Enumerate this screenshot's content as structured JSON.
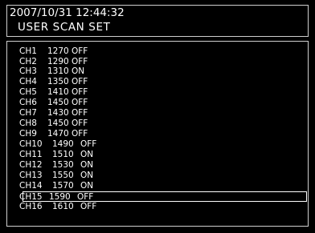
{
  "header": {
    "datetime": "2007/10/31  12:44:32",
    "title": "USER SCAN SET"
  },
  "channels": [
    {
      "ch": "CH1",
      "freq": "1270",
      "state": "OFF"
    },
    {
      "ch": "CH2",
      "freq": "1290",
      "state": "OFF"
    },
    {
      "ch": "CH3",
      "freq": "1310",
      "state": "ON"
    },
    {
      "ch": "CH4",
      "freq": "1350",
      "state": "OFF"
    },
    {
      "ch": "CH5",
      "freq": "1410",
      "state": "OFF"
    },
    {
      "ch": "CH6",
      "freq": "1450",
      "state": "OFF"
    },
    {
      "ch": "CH7",
      "freq": "1430",
      "state": "OFF"
    },
    {
      "ch": "CH8",
      "freq": "1450",
      "state": "OFF"
    },
    {
      "ch": "CH9",
      "freq": "1470",
      "state": "OFF"
    },
    {
      "ch": "CH10",
      "freq": "1490",
      "state": "OFF"
    },
    {
      "ch": "CH11",
      "freq": "1510",
      "state": "ON"
    },
    {
      "ch": "CH12",
      "freq": "1530",
      "state": "ON"
    },
    {
      "ch": "CH13",
      "freq": "1550",
      "state": "ON"
    },
    {
      "ch": "CH14",
      "freq": "1570",
      "state": "ON"
    },
    {
      "ch": "CH15",
      "freq": "1590",
      "state": "OFF"
    },
    {
      "ch": "CH16",
      "freq": "1610",
      "state": "OFF"
    }
  ],
  "selected_channel": "CH15"
}
